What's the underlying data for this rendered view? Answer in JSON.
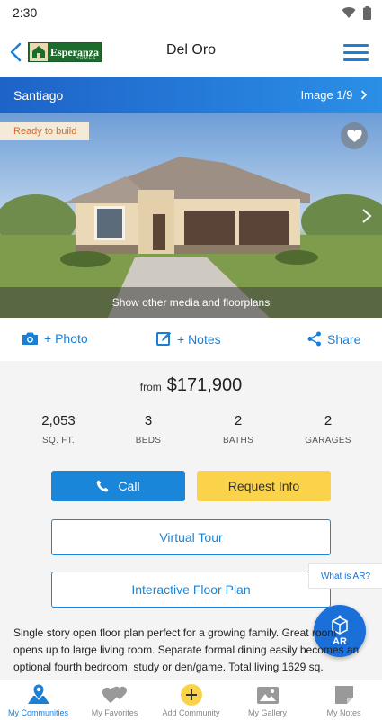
{
  "status": {
    "time": "2:30"
  },
  "header": {
    "title": "Del Oro",
    "logo_text": "Esperanza",
    "logo_sub": "HOMES"
  },
  "band": {
    "community": "Santiago",
    "image_counter": "Image 1/9"
  },
  "hero": {
    "badge": "Ready to build",
    "overlay_text": "Show other media and floorplans"
  },
  "actions": {
    "photo": "+ Photo",
    "notes": "+ Notes",
    "share": "Share"
  },
  "price": {
    "prefix": "from",
    "amount": "$171,900"
  },
  "stats": [
    {
      "value": "2,053",
      "label": "SQ. FT."
    },
    {
      "value": "3",
      "label": "BEDS"
    },
    {
      "value": "2",
      "label": "BATHS"
    },
    {
      "value": "2",
      "label": "GARAGES"
    }
  ],
  "buttons": {
    "call": "Call",
    "request_info": "Request Info",
    "virtual_tour": "Virtual Tour",
    "floor_plan": "Interactive Floor Plan"
  },
  "ar": {
    "hint": "What is AR?",
    "label": "AR"
  },
  "description": "Single story open floor plan perfect for a growing family. Great room opens up to large living room. Separate formal dining easily becomes an optional fourth bedroom, study or den/game. Total living 1629 sq.",
  "tabs": [
    {
      "label": "My Communities",
      "icon": "map-pin-icon"
    },
    {
      "label": "My Favorites",
      "icon": "hearts-icon"
    },
    {
      "label": "Add Community",
      "icon": "plus-circle-icon"
    },
    {
      "label": "My Gallery",
      "icon": "gallery-icon"
    },
    {
      "label": "My Notes",
      "icon": "note-icon"
    }
  ],
  "colors": {
    "accent": "#1b7fd6",
    "band_start": "#1e63c8",
    "band_end": "#2b8fe6",
    "request_info": "#fbd34b",
    "ar_button": "#1a6fd8",
    "badge_text": "#d46a2a"
  }
}
